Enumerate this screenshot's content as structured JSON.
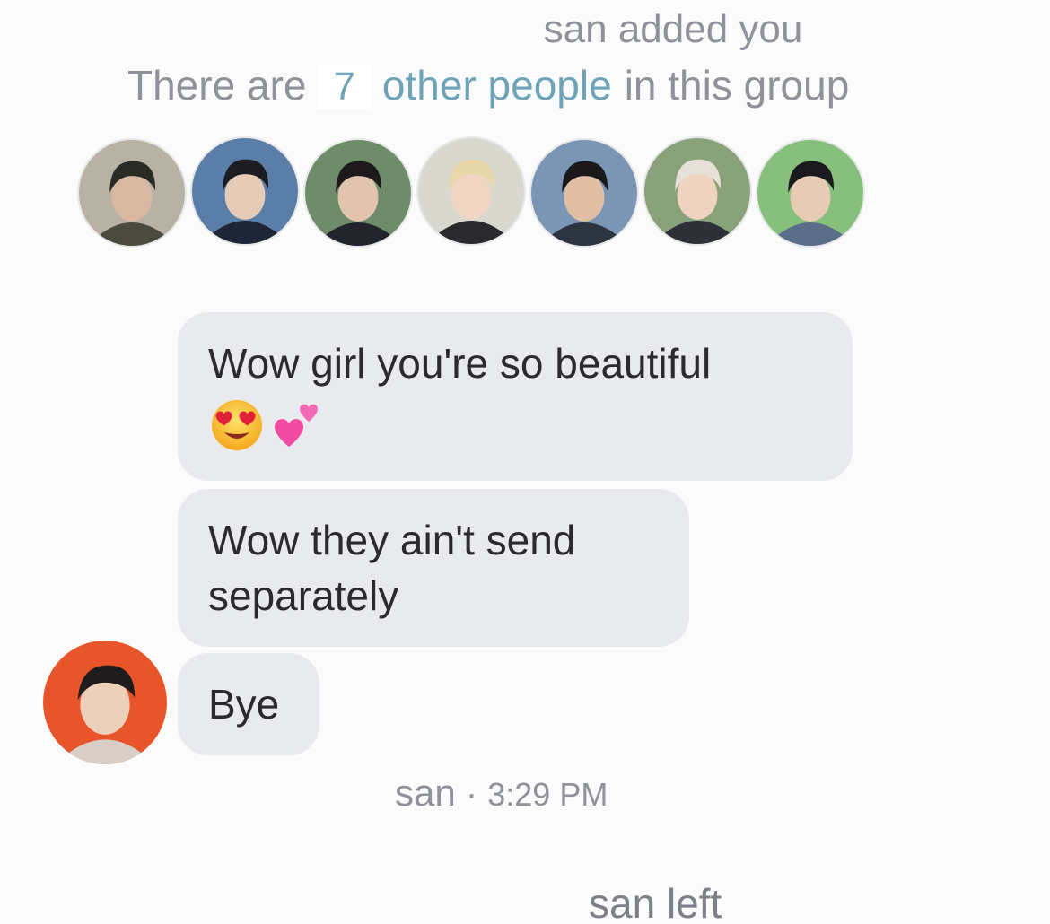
{
  "system": {
    "added": "san added you",
    "group_prefix": "There are",
    "group_count": "7",
    "group_link": "other people",
    "group_suffix": "in this group",
    "left": "san left"
  },
  "members": [
    {
      "name": "member-1",
      "bg": "#b8b2a4",
      "hair": "#2b2b26",
      "skin": "#d8b8a0",
      "outfit": "#4a4a3e"
    },
    {
      "name": "member-2",
      "bg": "#5a7ea8",
      "hair": "#1c1c22",
      "skin": "#e6cbb6",
      "outfit": "#1e2636"
    },
    {
      "name": "member-3",
      "bg": "#6f8c6a",
      "hair": "#1c1a1a",
      "skin": "#e2c4ae",
      "outfit": "#22242c"
    },
    {
      "name": "member-4",
      "bg": "#d8d8cf",
      "hair": "#e8d7a8",
      "skin": "#f0d6c2",
      "outfit": "#2a2a2e"
    },
    {
      "name": "member-5",
      "bg": "#7a96b4",
      "hair": "#1a1818",
      "skin": "#e0bfa4",
      "outfit": "#2c3440"
    },
    {
      "name": "member-6",
      "bg": "#8aa27a",
      "hair": "#e6e0d8",
      "skin": "#eed4c0",
      "outfit": "#2e3038"
    },
    {
      "name": "member-7",
      "bg": "#86c07c",
      "hair": "#1a1a1e",
      "skin": "#e8cbb4",
      "outfit": "#5a6e8a"
    }
  ],
  "messages": [
    {
      "text": "Wow girl you're so beautiful",
      "emojis": [
        "heart-eyes-emoji",
        "two-hearts-emoji"
      ]
    },
    {
      "text": "Wow they ain't send separately"
    },
    {
      "text": "Bye"
    }
  ],
  "sender": {
    "name": "san",
    "time": "3:29 PM",
    "separator": " · ",
    "avatar_bg": "#e8552a",
    "avatar_hair": "#1e1c1c",
    "avatar_skin": "#ecd0ba",
    "avatar_outfit": "#d8cfc6"
  },
  "colors": {
    "bubble": "#e9eaee",
    "system_text": "#8f9298",
    "link": "#6ea3b8",
    "message_text": "#2b2b2d"
  }
}
